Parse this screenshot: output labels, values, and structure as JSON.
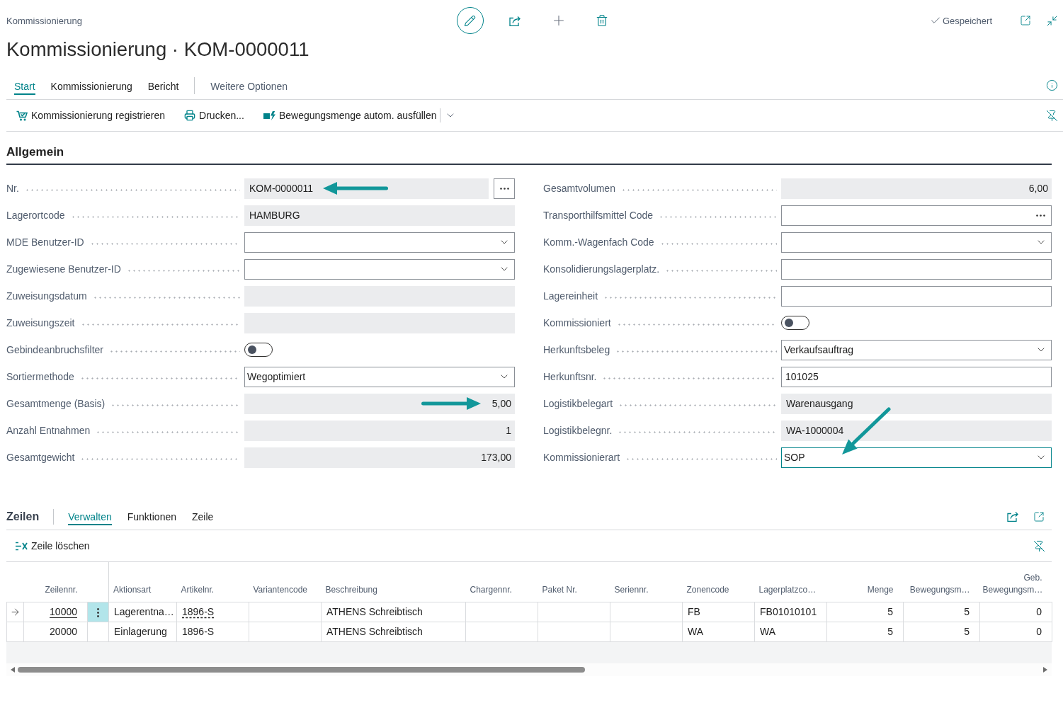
{
  "header": {
    "breadcrumb": "Kommissionierung",
    "title": "Kommissionierung · KOM-0000011",
    "save_status": "Gespeichert"
  },
  "tabs": [
    {
      "label": "Start",
      "selected": true
    },
    {
      "label": "Kommissionierung",
      "selected": false
    },
    {
      "label": "Bericht",
      "selected": false
    }
  ],
  "more_options": "Weitere Optionen",
  "actions": [
    "Kommissionierung registrieren",
    "Drucken...",
    "Bewegungsmenge autom. ausfüllen"
  ],
  "general": {
    "title": "Allgemein",
    "left_fields": [
      {
        "label": "Nr.",
        "kind": "lookup_button",
        "value": "KOM-0000011",
        "focused": false,
        "callout": {
          "kind": "arrow_left"
        }
      },
      {
        "label": "Lagerortcode",
        "kind": "readonly",
        "value": "HAMBURG",
        "focused": false
      },
      {
        "label": "MDE Benutzer-ID",
        "kind": "dropdown",
        "focused": false
      },
      {
        "label": "Zugewiesene Benutzer-ID",
        "kind": "dropdown",
        "focused": false
      },
      {
        "label": "Zuweisungsdatum",
        "kind": "readonly",
        "focused": false
      },
      {
        "label": "Zuweisungszeit",
        "kind": "readonly",
        "focused": false
      },
      {
        "label": "Gebindeanbruchsfilter",
        "kind": "toggle",
        "on": false,
        "focused": false
      },
      {
        "label": "Sortiermethode",
        "kind": "dropdown",
        "value": "Wegoptimiert",
        "focused": false
      },
      {
        "label": "Gesamtmenge (Basis)",
        "kind": "number",
        "value": "5,00",
        "focused": false,
        "callout": {
          "kind": "arrow_right"
        }
      },
      {
        "label": "Anzahl Entnahmen",
        "kind": "number",
        "value": "1",
        "focused": false
      },
      {
        "label": "Gesamtgewicht",
        "kind": "number",
        "value": "173,00",
        "focused": false
      }
    ],
    "right_fields": [
      {
        "label": "Gesamtvolumen",
        "kind": "number",
        "value": "6,00",
        "focused": false
      },
      {
        "label": "Transporthilfsmittel Code",
        "kind": "lookup",
        "focused": false
      },
      {
        "label": "Komm.-Wagenfach Code",
        "kind": "dropdown",
        "focused": false
      },
      {
        "label": "Konsolidierungslagerplatz.",
        "kind": "input",
        "focused": false
      },
      {
        "label": "Lagereinheit",
        "kind": "input",
        "focused": false
      },
      {
        "label": "Kommissioniert",
        "kind": "toggle",
        "on": false,
        "focused": false
      },
      {
        "label": "Herkunftsbeleg",
        "kind": "dropdown",
        "value": "Verkaufsauftrag",
        "focused": false
      },
      {
        "label": "Herkunftsnr.",
        "kind": "input",
        "value": "101025",
        "focused": false
      },
      {
        "label": "Logistikbelegart",
        "kind": "readonly",
        "value": "Warenausgang",
        "focused": false
      },
      {
        "label": "Logistikbelegnr.",
        "kind": "readonly",
        "value": "WA-1000004",
        "focused": false
      },
      {
        "label": "Kommissionierart",
        "kind": "dropdown",
        "value": "SOP",
        "focused": true,
        "callout": {
          "kind": "arrow_down_left"
        }
      }
    ]
  },
  "lines": {
    "title": "Zeilen",
    "tabs": [
      {
        "label": "Verwalten",
        "selected": true
      },
      {
        "label": "Funktionen",
        "selected": false
      },
      {
        "label": "Zeile",
        "selected": false
      }
    ],
    "actions": [
      "Zeile löschen"
    ],
    "columns": [
      {
        "label": "Zeilennr.",
        "kind": "line_no"
      },
      {
        "label": "Aktionsart",
        "kind": "text"
      },
      {
        "label": "Artikelnr.",
        "kind": "item"
      },
      {
        "label": "Variantencode",
        "kind": "text"
      },
      {
        "label": "Beschreibung",
        "kind": "text"
      },
      {
        "label": "Chargennr.",
        "kind": "text"
      },
      {
        "label": "Paket Nr.",
        "kind": "text"
      },
      {
        "label": "Seriennr.",
        "kind": "text"
      },
      {
        "label": "Zonencode",
        "kind": "text"
      },
      {
        "label": "Lagerplatzco…",
        "kind": "text"
      },
      {
        "label": "Menge",
        "kind": "number"
      },
      {
        "label": "Bewegungsm…",
        "kind": "number"
      },
      {
        "label": "Geb. Bewegungsm…",
        "kind": "number"
      }
    ],
    "rows": [
      {
        "selected": true,
        "cells": [
          "10000",
          "Lagerentna…",
          "1896-S",
          null,
          "ATHENS Schreibtisch",
          null,
          null,
          null,
          "FB",
          "FB01010101",
          "5",
          "5",
          "0"
        ]
      },
      {
        "selected": false,
        "cells": [
          "20000",
          "Einlagerung",
          "1896-S",
          null,
          "ATHENS Schreibtisch",
          null,
          null,
          null,
          "WA",
          "WA",
          "5",
          "5",
          "0"
        ]
      }
    ]
  }
}
